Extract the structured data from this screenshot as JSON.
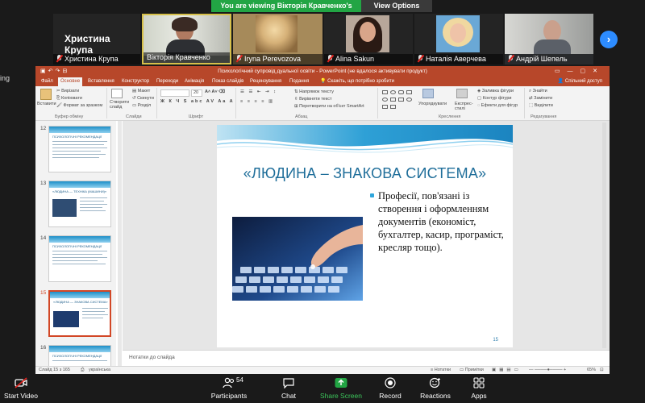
{
  "banner": {
    "message": "You are viewing Вікторія Кравченко's screen",
    "view_options": "View Options"
  },
  "participants": [
    {
      "name": "Христина Крупа",
      "big_label": "Христина Крупа",
      "muted": true
    },
    {
      "name": "Вікторія Кравченко",
      "muted": false,
      "active": true
    },
    {
      "name": "Iryna Perevozova",
      "muted": true
    },
    {
      "name": "Alina Sakun",
      "muted": true
    },
    {
      "name": "Наталія Аверчева",
      "muted": true
    },
    {
      "name": "Андрій Шепель",
      "muted": true
    }
  ],
  "left_edge_text": "ing",
  "powerpoint": {
    "title": "Психологічний супровід дуальної освіти - PowerPoint (не вдалося активувати продукт)",
    "tabs": [
      "Файл",
      "Основне",
      "Вставлення",
      "Конструктор",
      "Переходи",
      "Анімація",
      "Показ слайдів",
      "Рецензування",
      "Подання",
      "Скажіть, що потрібно зробити"
    ],
    "active_tab": "Основне",
    "share_label": "Спільний доступ",
    "ribbon": {
      "paste": "Вставити",
      "cut": "Вирізати",
      "copy": "Копіювати",
      "format_painter": "Формат за зразком",
      "clipboard_group": "Буфер обміну",
      "new_slide": "Створити слайд",
      "layout": "Макет",
      "reset": "Скинути",
      "section": "Розділ",
      "slides_group": "Слайди",
      "font_size": "20",
      "font_group": "Шрифт",
      "text_direction": "Напрямок тексту",
      "align_text": "Вирівняти текст",
      "smartart": "Перетворити на об'єкт SmartArt",
      "paragraph_group": "Абзац",
      "arrange": "Упорядкувати",
      "quick_styles": "Експрес-стилі",
      "shape_fill": "Заливка фігури",
      "shape_outline": "Контур фігури",
      "shape_effects": "Ефекти для фігур",
      "drawing_group": "Креслення",
      "find": "Знайти",
      "replace": "Замінити",
      "select": "Виділити",
      "editing_group": "Редагування"
    },
    "thumbnails": [
      {
        "num": "12",
        "title": "ПСИХОЛОГІЧНІ РЕКОМЕНДАЦІЇ"
      },
      {
        "num": "13",
        "title": "«ЛЮДИНА — ТЕХНІКА (МАШИНИ)»"
      },
      {
        "num": "14",
        "title": "ПСИХОЛОГІЧНІ РЕКОМЕНДАЦІЇ"
      },
      {
        "num": "15",
        "title": "«ЛЮДИНА — ЗНАКОВА СИСТЕМА»",
        "selected": true
      },
      {
        "num": "16",
        "title": "ПСИХОЛОГІЧНІ РЕКОМЕНДАЦІЇ"
      }
    ],
    "slide": {
      "title": "«ЛЮДИНА – ЗНАКОВА СИСТЕМА»",
      "bullet": "Професії, пов'язані із створення і оформленням документів (економіст, бухгалтер, касир, програміст, кресляр тощо).",
      "number": "15"
    },
    "notes_placeholder": "Нотатки до слайда",
    "status": {
      "slide_info": "Слайд 15 з 165",
      "language": "українська",
      "notes": "Нотатки",
      "comments": "Примітки",
      "zoom": "65%"
    }
  },
  "toolbar": {
    "start_video": "Start Video",
    "participants": "Participants",
    "participants_count": "54",
    "chat": "Chat",
    "share_screen": "Share Screen",
    "record": "Record",
    "reactions": "Reactions",
    "apps": "Apps"
  },
  "colors": {
    "zoom_green": "#22a544",
    "ppt_accent": "#b7472a",
    "slide_title": "#1f6e9a",
    "zoom_blue": "#2d8cff"
  }
}
